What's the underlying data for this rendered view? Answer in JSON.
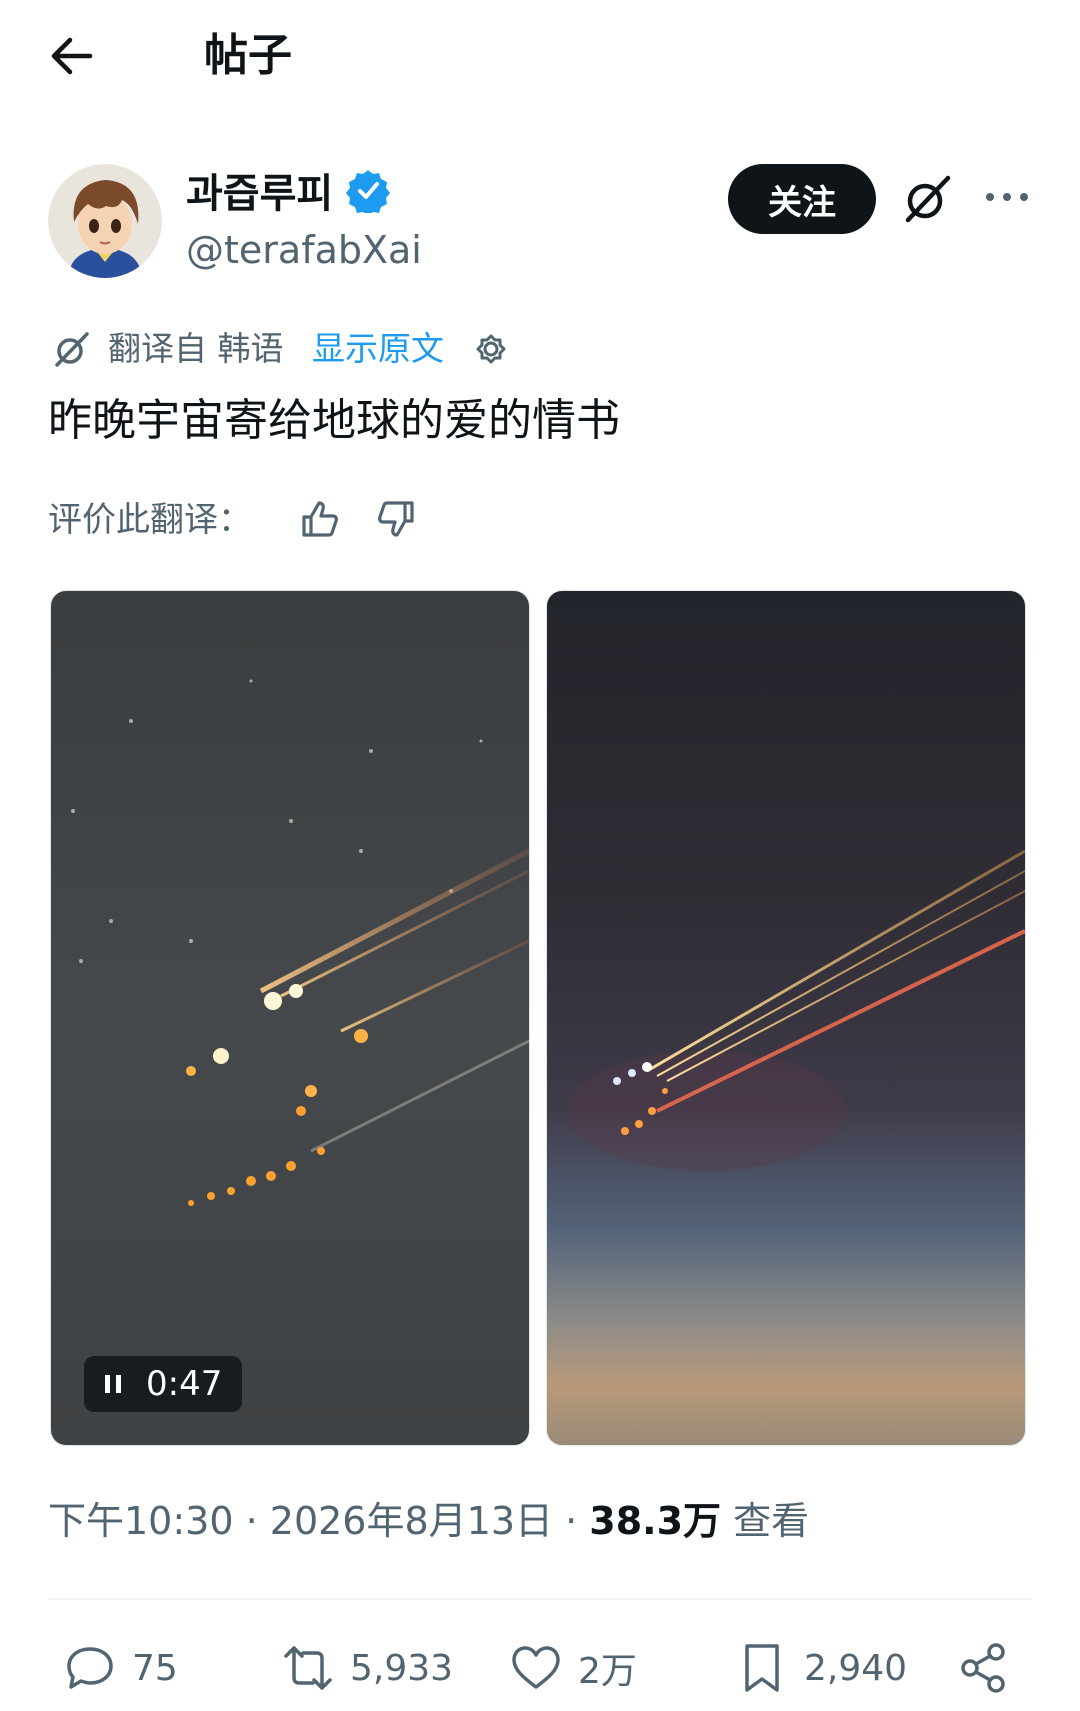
{
  "header": {
    "title": "帖子"
  },
  "author": {
    "name": "과즙루피",
    "handle": "@terafabXai",
    "follow_label": "关注"
  },
  "translation": {
    "source_text": "翻译自 韩语",
    "show_original_label": "显示原文"
  },
  "post": {
    "text": "昨晚宇宙寄给地球的爱的情书",
    "rate_label": "评价此翻译："
  },
  "media": {
    "video_time": "0:47"
  },
  "meta": {
    "time": "下午10:30",
    "sep1": " · ",
    "date": "2026年8月13日",
    "sep2": " · ",
    "views_count": "38.3万",
    "views_label": " 查看"
  },
  "actions": {
    "replies": "75",
    "reposts": "5,933",
    "likes": "2万",
    "bookmarks": "2,940"
  },
  "colors": {
    "text": "#0f1419",
    "secondary": "#536471",
    "link": "#1d9bf0",
    "verified": "#1d9bf0"
  }
}
